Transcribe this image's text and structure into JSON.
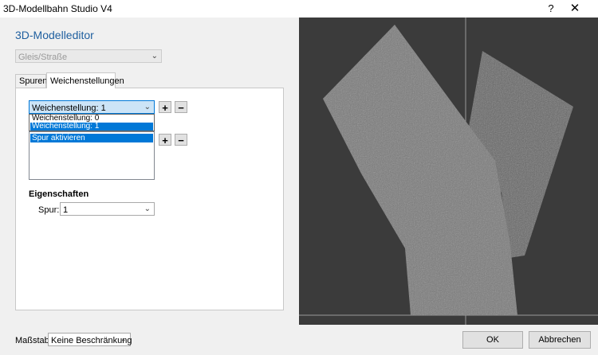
{
  "window": {
    "title": "3D-Modellbahn Studio V4",
    "help_glyph": "?",
    "close_glyph": "✕"
  },
  "editor": {
    "heading": "3D-Modelleditor",
    "type_select": {
      "value": "Gleis/Straße",
      "disabled": true
    }
  },
  "tabs": [
    {
      "label": "Spuren",
      "selected": false
    },
    {
      "label": "Weichenstellungen",
      "selected": true
    }
  ],
  "switch": {
    "select_value": "Weichenstellung: 1",
    "options": [
      "Weichenstellung: 0",
      "Weichenstellung: 1"
    ],
    "highlighted_option": 1,
    "add_glyph": "+",
    "remove_glyph": "−"
  },
  "actions": {
    "items": [
      "Spur aktivieren"
    ],
    "add_glyph": "+",
    "remove_glyph": "−"
  },
  "properties": {
    "heading": "Eigenschaften",
    "track_label": "Spur:",
    "track_value": "1"
  },
  "statusbar": {
    "scale_label": "Maßstab:",
    "scale_value": "Keine Beschränkung",
    "ok_label": "OK",
    "cancel_label": "Abbrechen"
  },
  "viewport": {
    "background": "#3b3b3b",
    "track_color": "#7a7a7a",
    "track_back_color": "#666666",
    "axis_color": "#9a9a9a"
  }
}
